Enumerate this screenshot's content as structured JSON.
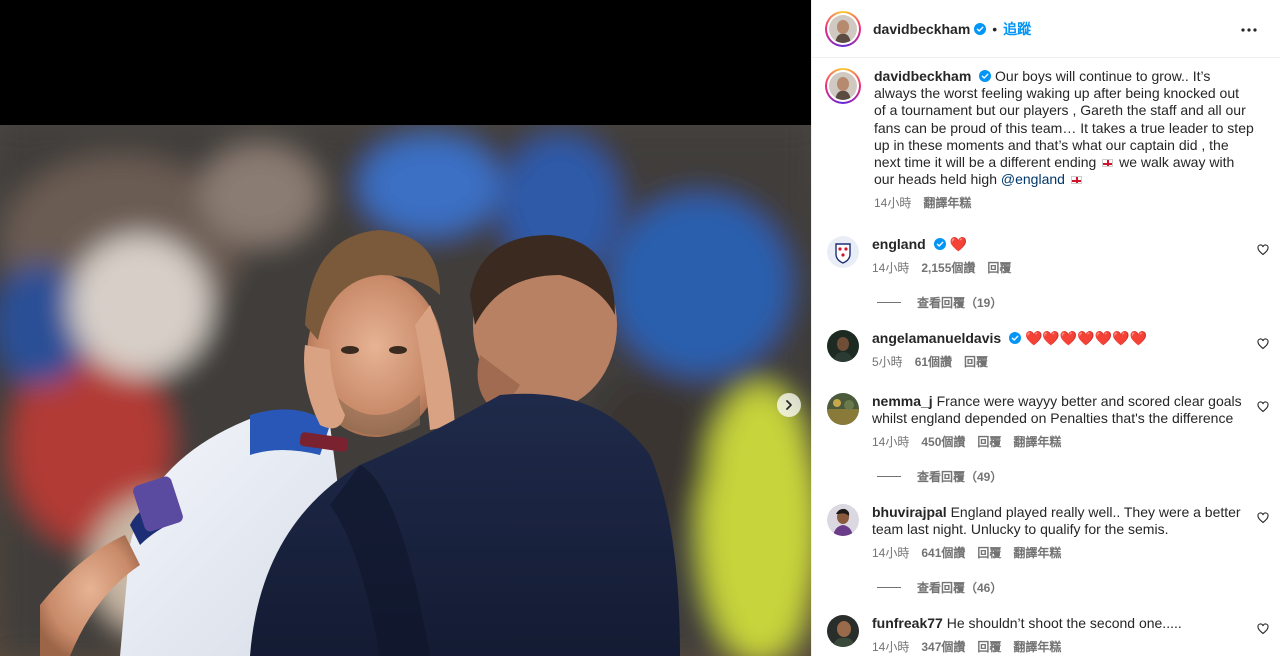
{
  "header": {
    "username": "davidbeckham",
    "separator": "•",
    "follow_label": "追蹤",
    "more_icon": "more-horizontal-icon"
  },
  "caption": {
    "username": "davidbeckham",
    "text_part1": "Our boys will continue to grow.. It’s always the worst feeling waking up after being knocked out of a tournament but our players , Gareth the staff and all our fans can be proud of this team… It takes a true leader to step up in these moments and that’s what our captain did , the next time it will be a different ending",
    "text_part2": "we walk away with our heads held high",
    "mention": "@england",
    "time": "14小時",
    "see_translation": "翻譯年糕"
  },
  "comments": [
    {
      "username": "england",
      "verified": true,
      "text": "❤️",
      "time": "14小時",
      "likes": "2,155個讚",
      "reply": "回覆",
      "translate": "",
      "view_replies": "查看回覆（19）"
    },
    {
      "username": "angelamanueldavis",
      "verified": true,
      "text": "❤️❤️❤️❤️❤️❤️❤️",
      "time": "5小時",
      "likes": "61個讚",
      "reply": "回覆",
      "translate": "",
      "view_replies": ""
    },
    {
      "username": "nemma_j",
      "verified": false,
      "text": "France were wayyy better and scored clear goals whilst england depended on Penalties that's the difference",
      "time": "14小時",
      "likes": "450個讚",
      "reply": "回覆",
      "translate": "翻譯年糕",
      "view_replies": "查看回覆（49）"
    },
    {
      "username": "bhuvirajpal",
      "verified": false,
      "text": "England played really well.. They were a better team last night. Unlucky to qualify for the semis.",
      "time": "14小時",
      "likes": "641個讚",
      "reply": "回覆",
      "translate": "翻譯年糕",
      "view_replies": "查看回覆（46）"
    },
    {
      "username": "funfreak77",
      "verified": false,
      "text": "He shouldn’t shoot the second one.....",
      "time": "14小時",
      "likes": "347個讚",
      "reply": "回覆",
      "translate": "翻譯年糕",
      "view_replies": ""
    }
  ],
  "media": {
    "next_icon": "chevron-right-icon"
  },
  "colors": {
    "link_blue": "#0095f6",
    "mention_blue": "#00376b",
    "secondary_text": "#737373",
    "like_red": "#ed4956"
  }
}
